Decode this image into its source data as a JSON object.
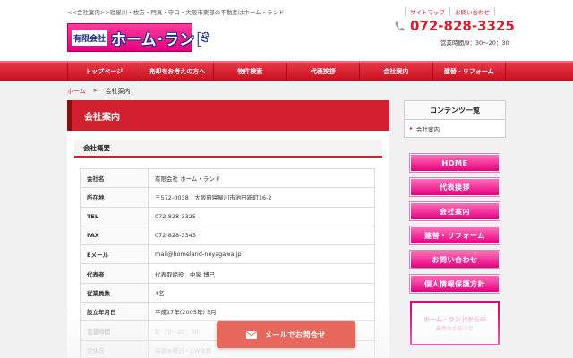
{
  "header": {
    "tagline": "<<会社案内>>寝屋川・枚方・門真・守口・大阪市東部の不動産はホーム・ランド",
    "logo_small": "有限会社",
    "logo_big": "ホーム･ランド",
    "top_links": [
      "サイトマップ",
      "お問い合わせ"
    ],
    "phone": "072-828-3325",
    "hours": "営業時間/9：30〜20：30"
  },
  "nav": {
    "items": [
      "トップページ",
      "売却をお考えの方へ",
      "物件検索",
      "代表挨拶",
      "会社案内",
      "建替・リフォーム"
    ]
  },
  "breadcrumb": {
    "home": "ホーム",
    "sep": ">",
    "current": "会社案内"
  },
  "main": {
    "title": "会社案内",
    "section_title": "会社概要",
    "rows": [
      {
        "key": "会社名",
        "value": "有限会社 ホーム・ランド"
      },
      {
        "key": "所在地",
        "value": "〒572-0038　大阪府寝屋川市池田新町16-2"
      },
      {
        "key": "TEL",
        "value": "072-828-3325"
      },
      {
        "key": "FAX",
        "value": "072-828-3343"
      },
      {
        "key": "Eメール",
        "value": "mail@homeland-neyagawa.jp"
      },
      {
        "key": "代表者",
        "value": "代表取締役　中家 博己"
      },
      {
        "key": "従業員数",
        "value": "4名"
      },
      {
        "key": "設立年月日",
        "value": "平成17年(2005年) 5月"
      },
      {
        "key": "営業時間",
        "value": "9：30〜20：30"
      },
      {
        "key": "定休日",
        "value": "毎週水曜日・GW休暇"
      }
    ]
  },
  "sidebar": {
    "heading": "コンテンツ一覧",
    "item": "会社案内",
    "arrow": "▸",
    "buttons": [
      "HOME",
      "代表挨拶",
      "会社案内",
      "建替・リフォーム",
      "お問い合わせ",
      "個人情報保護方針"
    ],
    "banner_line1": "ホーム・ランドからの",
    "banner_line2": "最新のお知らせ"
  },
  "mail_button": {
    "label": "メールでお問合せ"
  },
  "colors": {
    "accent": "#d3202f",
    "pink": "#e5007f",
    "mail": "#e9685e"
  }
}
